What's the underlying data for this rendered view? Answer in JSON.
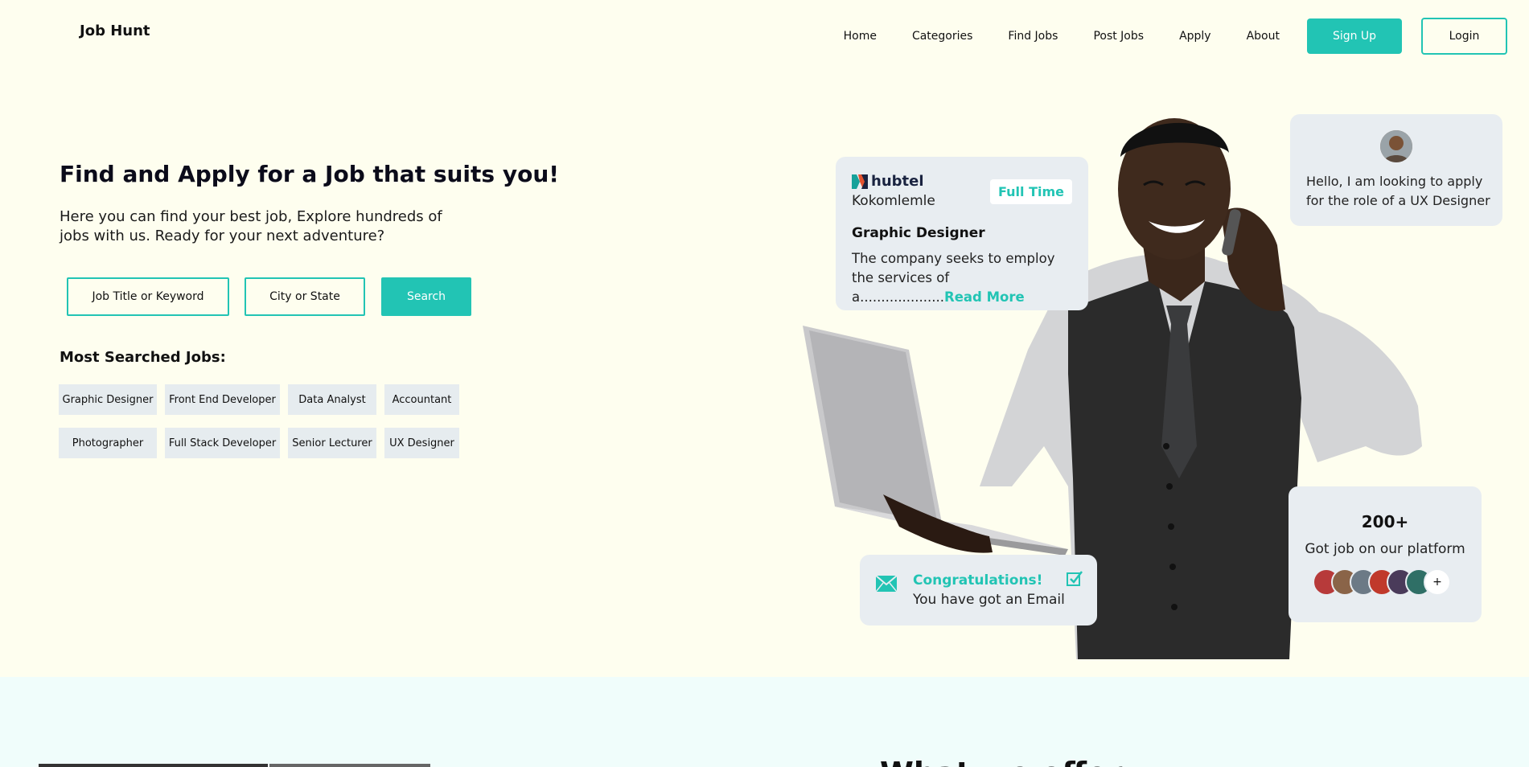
{
  "header": {
    "brand": "Job Hunt",
    "nav": [
      "Home",
      "Categories",
      "Find Jobs",
      "Post Jobs",
      "Apply",
      "About"
    ],
    "signup_label": "Sign Up",
    "login_label": "Login"
  },
  "hero": {
    "title": "Find and Apply for a Job that suits you!",
    "subtitle": "Here you can find your best job, Explore hundreds of jobs with us. Ready for your next adventure?",
    "search": {
      "job_placeholder": "Job Title or Keyword",
      "city_placeholder": "City or State",
      "button_label": "Search"
    },
    "most_searched_title": "Most Searched Jobs:",
    "tags": [
      "Graphic Designer",
      "Front End Developer",
      "Data Analyst",
      "Accountant",
      "Photographer",
      "Full Stack Developer",
      "Senior Lecturer",
      "UX Designer"
    ]
  },
  "job_card": {
    "company": "hubtel",
    "location": "Kokomlemle",
    "type": "Full Time",
    "title": "Graphic Designer",
    "description": "The company seeks to employ the services of a....................",
    "read_more": "Read More"
  },
  "message_card": {
    "text": "Hello, I am looking to apply for the role of a UX Designer"
  },
  "stat_card": {
    "number": "200+",
    "label": "Got job on our platform",
    "plus": "+"
  },
  "notification_card": {
    "title": "Congratulations!",
    "text": "You have got an Email"
  },
  "section2": {
    "title": "What we offer"
  },
  "colors": {
    "accent": "#22c4b4",
    "background": "#fefeef",
    "card": "#e8edf1",
    "section2_bg": "#f0fdfb"
  }
}
